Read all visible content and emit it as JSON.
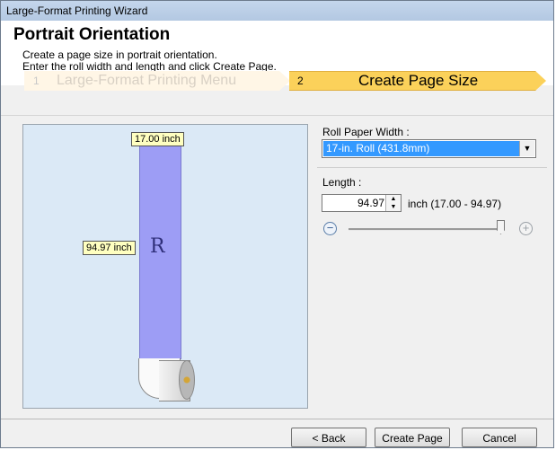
{
  "window": {
    "title": "Large-Format Printing Wizard"
  },
  "header": {
    "title": "Portrait Orientation",
    "line1": "Create a page size in portrait orientation.",
    "line2": "Enter the roll width and length and click Create Page."
  },
  "steps": [
    {
      "number": "1",
      "label": "Large-Format Printing Menu",
      "state": "inactive"
    },
    {
      "number": "2",
      "label": "Create Page Size",
      "state": "active"
    }
  ],
  "preview": {
    "width_tag": "17.00 inch",
    "length_tag": "94.97 inch",
    "letter": "R"
  },
  "roll_paper": {
    "label": "Roll Paper Width :",
    "selected": "17-in. Roll (431.8mm)"
  },
  "length": {
    "label": "Length :",
    "value": "94.97",
    "unit_range": "inch  (17.00 - 94.97)",
    "slider_fraction": 1.0
  },
  "buttons": {
    "back": "< Back",
    "create": "Create Page",
    "cancel": "Cancel"
  },
  "icons": {
    "zoom_out": "minus-circle-icon",
    "zoom_in": "plus-circle-icon",
    "dropdown": "chevron-down-icon",
    "spin": "spinner-arrows-icon"
  },
  "colors": {
    "active_step": "#fbd15a",
    "selection": "#3399ff",
    "paper": "#9d9df5"
  }
}
